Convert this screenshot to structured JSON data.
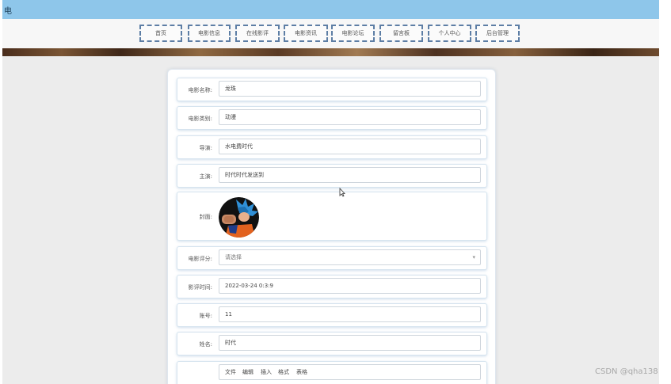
{
  "window": {
    "title": "电"
  },
  "nav": {
    "items": [
      {
        "label": "首页"
      },
      {
        "label": "电影信息"
      },
      {
        "label": "在线影评"
      },
      {
        "label": "电影资讯"
      },
      {
        "label": "电影论坛"
      },
      {
        "label": "留言板"
      },
      {
        "label": "个人中心"
      },
      {
        "label": "后台管理"
      }
    ]
  },
  "form": {
    "movie_name": {
      "label": "电影名称:",
      "value": "龙珠"
    },
    "category": {
      "label": "电影类别:",
      "value": "动漫"
    },
    "director": {
      "label": "导演:",
      "value": "水电费时代"
    },
    "starring": {
      "label": "主演:",
      "value": "时代时代发送到"
    },
    "cover": {
      "label": "封面:"
    },
    "rating": {
      "label": "电影评分:",
      "placeholder": "请选择"
    },
    "review_time": {
      "label": "影评时间:",
      "value": "2022-03-24 0:3:9"
    },
    "account": {
      "label": "账号:",
      "value": "11"
    },
    "name": {
      "label": "姓名:",
      "value": "时代"
    },
    "editor_toolbar": [
      "文件",
      "编辑",
      "插入",
      "格式",
      "表格"
    ]
  },
  "colors": {
    "topbar": "#8ec6ea",
    "nav_border": "#5d7ea5",
    "background": "#ececec"
  },
  "watermark": "CSDN @qha138"
}
